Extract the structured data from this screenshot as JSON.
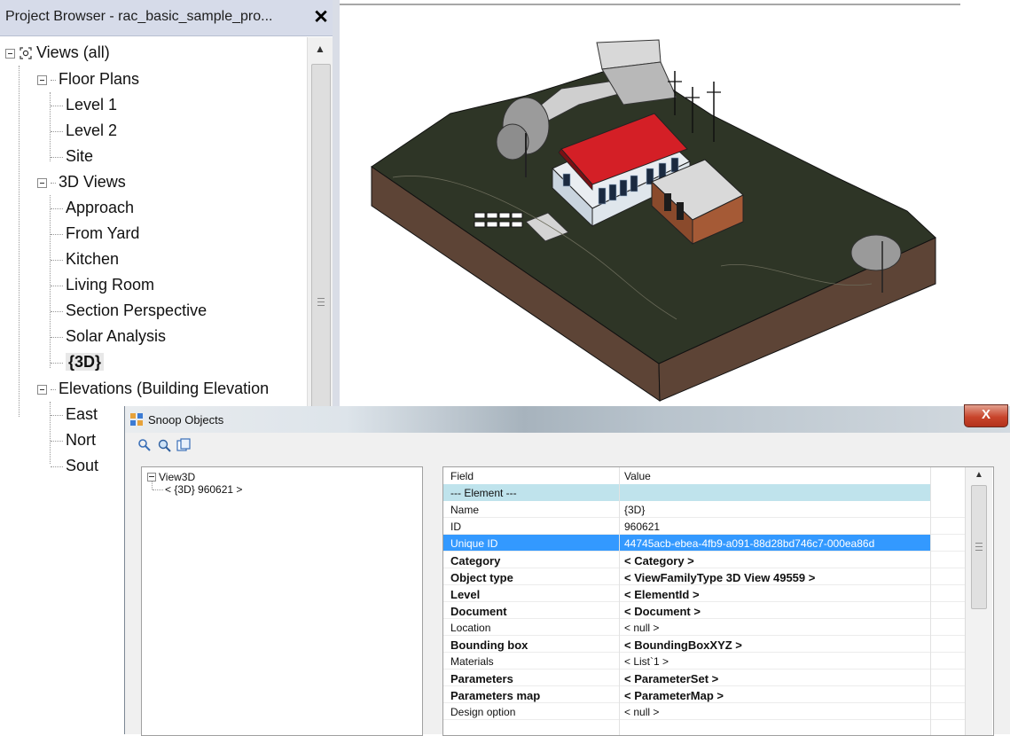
{
  "project_browser": {
    "title": "Project Browser - rac_basic_sample_pro...",
    "close": "✕",
    "root": "Views (all)",
    "groups": [
      {
        "label": "Floor Plans",
        "items": [
          "Level 1",
          "Level 2",
          "Site"
        ]
      },
      {
        "label": "3D Views",
        "items": [
          "Approach",
          "From Yard",
          "Kitchen",
          "Living Room",
          "Section Perspective",
          "Solar Analysis",
          "{3D}"
        ]
      },
      {
        "label": "Elevations (Building Elevation",
        "items": [
          "East",
          "Nort",
          "Sout"
        ]
      }
    ],
    "selected_item": "{3D}"
  },
  "snoop": {
    "title": "Snoop Objects",
    "close": "X",
    "tree": {
      "root": "View3D",
      "child": "< {3D}  960621 >"
    },
    "grid": {
      "headers": {
        "field": "Field",
        "value": "Value"
      },
      "section": "--- Element ---",
      "rows": [
        {
          "field": "Name",
          "value": "{3D}",
          "bold": false
        },
        {
          "field": "ID",
          "value": "960621",
          "bold": false
        },
        {
          "field": "Unique ID",
          "value": "44745acb-ebea-4fb9-a091-88d28bd746c7-000ea86d",
          "bold": false
        },
        {
          "field": "Category",
          "value": "< Category >",
          "bold": true
        },
        {
          "field": "Object type",
          "value": "< ViewFamilyType  3D View  49559 >",
          "bold": true
        },
        {
          "field": "Level",
          "value": "< ElementId >",
          "bold": true
        },
        {
          "field": "Document",
          "value": "< Document >",
          "bold": true
        },
        {
          "field": "Location",
          "value": "< null >",
          "bold": false
        },
        {
          "field": "Bounding box",
          "value": "< BoundingBoxXYZ >",
          "bold": true
        },
        {
          "field": "Materials",
          "value": "< List`1 >",
          "bold": false
        },
        {
          "field": "Parameters",
          "value": "< ParameterSet >",
          "bold": true
        },
        {
          "field": "Parameters map",
          "value": "< ParameterMap >",
          "bold": true
        },
        {
          "field": "Design option",
          "value": "< null >",
          "bold": false
        }
      ],
      "selected_row": "Unique ID"
    }
  },
  "colors": {
    "terrain_top": "#2e3526",
    "terrain_side": "#5d4436",
    "roof": "#d41f26",
    "selection": "#3399ff",
    "section_row": "#bfe3ec"
  }
}
